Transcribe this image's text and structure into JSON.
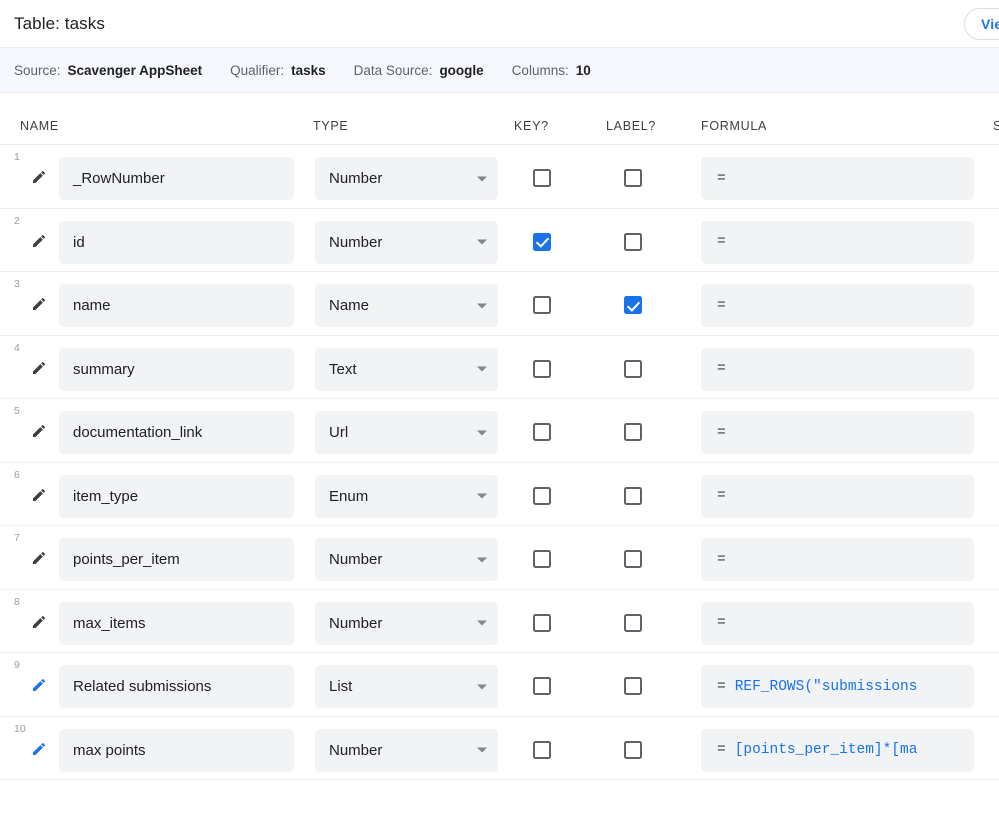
{
  "header": {
    "title": "Table: tasks",
    "view_button_label": "View Source"
  },
  "info_bar": [
    {
      "label": "Source:",
      "value": "Scavenger AppSheet"
    },
    {
      "label": "Qualifier:",
      "value": "tasks"
    },
    {
      "label": "Data Source:",
      "value": "google"
    },
    {
      "label": "Columns:",
      "value": "10"
    }
  ],
  "columns": {
    "name": "NAME",
    "type": "TYPE",
    "key": "KEY?",
    "label": "LABEL?",
    "formula": "FORMULA",
    "show": "S"
  },
  "colors": {
    "accent": "#1a73e8",
    "field_bg": "#f1f3f4",
    "info_bar_bg": "#f6f8fe",
    "text_primary": "#202124",
    "text_secondary": "#5f6368"
  },
  "rows": [
    {
      "num": "1",
      "name": "_RowNumber",
      "type": "Number",
      "key": false,
      "label": false,
      "eq": "=",
      "formula": "",
      "pencil_active": false
    },
    {
      "num": "2",
      "name": "id",
      "type": "Number",
      "key": true,
      "label": false,
      "eq": "=",
      "formula": "",
      "pencil_active": false
    },
    {
      "num": "3",
      "name": "name",
      "type": "Name",
      "key": false,
      "label": true,
      "eq": "=",
      "formula": "",
      "pencil_active": false
    },
    {
      "num": "4",
      "name": "summary",
      "type": "Text",
      "key": false,
      "label": false,
      "eq": "=",
      "formula": "",
      "pencil_active": false
    },
    {
      "num": "5",
      "name": "documentation_link",
      "type": "Url",
      "key": false,
      "label": false,
      "eq": "=",
      "formula": "",
      "pencil_active": false
    },
    {
      "num": "6",
      "name": "item_type",
      "type": "Enum",
      "key": false,
      "label": false,
      "eq": "=",
      "formula": "",
      "pencil_active": false
    },
    {
      "num": "7",
      "name": "points_per_item",
      "type": "Number",
      "key": false,
      "label": false,
      "eq": "=",
      "formula": "",
      "pencil_active": false
    },
    {
      "num": "8",
      "name": "max_items",
      "type": "Number",
      "key": false,
      "label": false,
      "eq": "=",
      "formula": "",
      "pencil_active": false
    },
    {
      "num": "9",
      "name": "Related submissions",
      "type": "List",
      "key": false,
      "label": false,
      "eq": "=",
      "formula": "REF_ROWS(\"submissions",
      "pencil_active": true
    },
    {
      "num": "10",
      "name": "max points",
      "type": "Number",
      "key": false,
      "label": false,
      "eq": "=",
      "formula": "[points_per_item]*[ma",
      "pencil_active": true
    }
  ]
}
